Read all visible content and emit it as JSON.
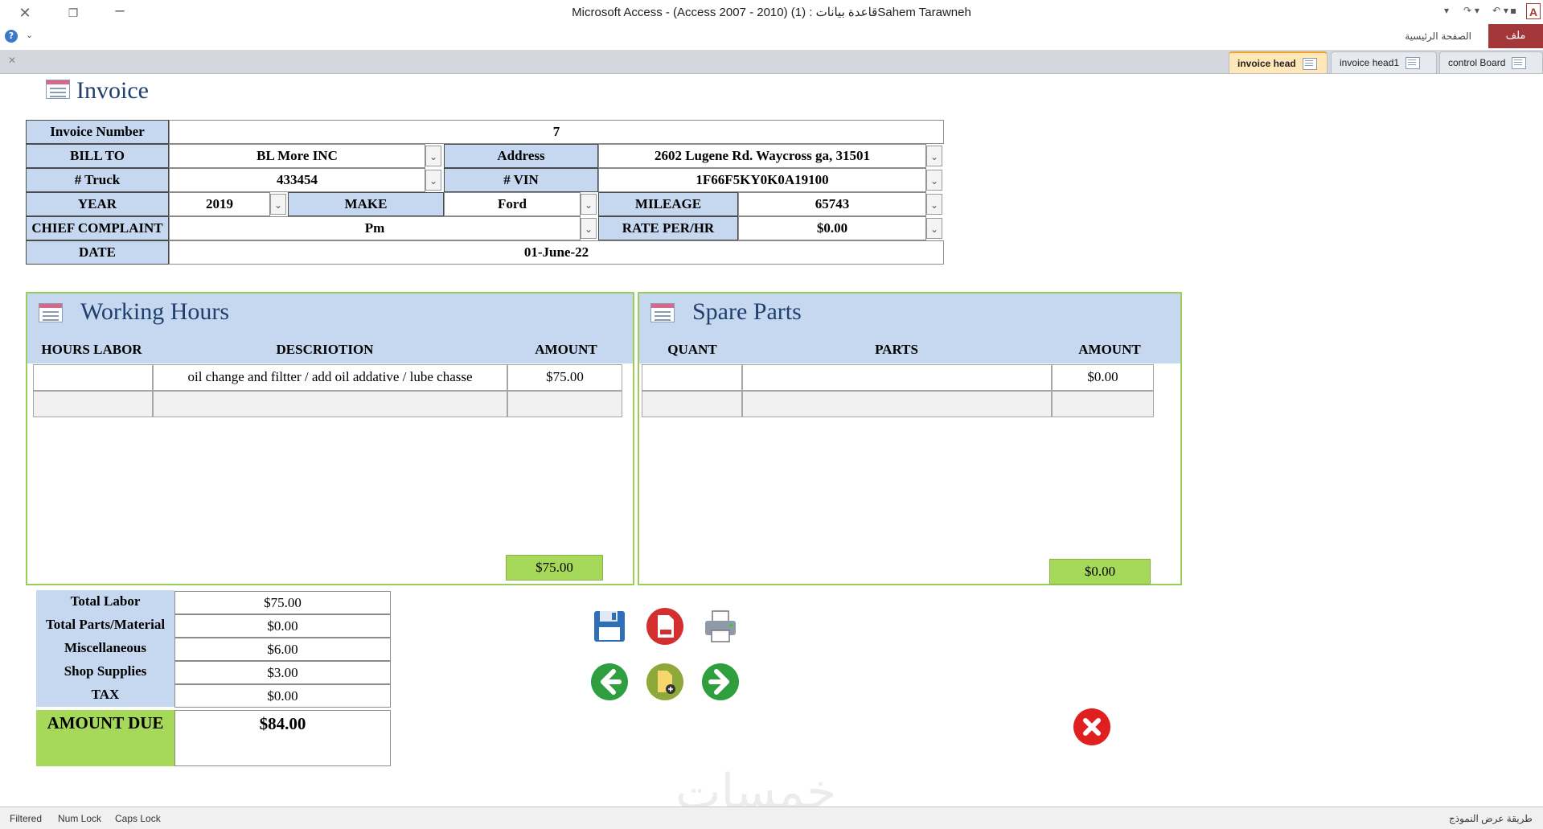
{
  "window": {
    "title": "Microsoft Access  -  (Access 2007 - 2010) قاعدة بيانات : (1)Sahem Tarawneh",
    "file_tab": "ملف",
    "home_tab": "الصفحة الرئيسية",
    "brand_letter": "A"
  },
  "tabs": [
    {
      "label": "invoice head",
      "active": true
    },
    {
      "label": "invoice head1",
      "active": false
    },
    {
      "label": "control Board",
      "active": false
    }
  ],
  "form": {
    "title": "Invoice",
    "invoice_number_label": "Invoice Number",
    "invoice_number": "7",
    "bill_to_label": "BILL TO",
    "bill_to": "BL More INC",
    "address_label": "Address",
    "address": "2602 Lugene Rd. Waycross ga, 31501",
    "truck_label": "# Truck",
    "truck": "433454",
    "vin_label": "# VIN",
    "vin": "1F66F5KY0K0A19100",
    "year_label": "YEAR",
    "year": "2019",
    "make_label": "MAKE",
    "make": "Ford",
    "mileage_label": "MILEAGE",
    "mileage": "65743",
    "complaint_label": "CHIEF COMPLAINT",
    "complaint": "Pm",
    "rate_label": "RATE PER/HR",
    "rate": "$0.00",
    "date_label": "DATE",
    "date": "01-June-22"
  },
  "working_hours": {
    "title": "Working Hours",
    "columns": [
      "HOURS LABOR",
      "DESCRIOTION",
      "AMOUNT"
    ],
    "rows": [
      {
        "hours": "",
        "description": "oil change and filtter / add oil addative / lube chasse",
        "amount": "$75.00"
      }
    ],
    "total": "$75.00"
  },
  "spare_parts": {
    "title": "Spare Parts",
    "columns": [
      "QUANT",
      "PARTS",
      "AMOUNT"
    ],
    "rows": [
      {
        "quant": "",
        "parts": "",
        "amount": "$0.00"
      }
    ],
    "total": "$0.00"
  },
  "totals": {
    "total_labor_label": "Total Labor",
    "total_labor": "$75.00",
    "total_parts_label": "Total Parts/Material",
    "total_parts": "$0.00",
    "misc_label": "Miscellaneous",
    "misc": "$6.00",
    "supplies_label": "Shop Supplies",
    "supplies": "$3.00",
    "tax_label": "TAX",
    "tax": "$0.00",
    "amount_due_label": "AMOUNT DUE",
    "amount_due": "$84.00"
  },
  "status": {
    "filtered": "Filtered",
    "num_lock": "Num Lock",
    "caps_lock": "Caps Lock",
    "view_mode": "طريقة عرض النموذج"
  },
  "colors": {
    "label_bg": "#c5d8ef",
    "green": "#a6d85a",
    "file_tab": "#a4373a",
    "title_text": "#1f3f6e"
  }
}
